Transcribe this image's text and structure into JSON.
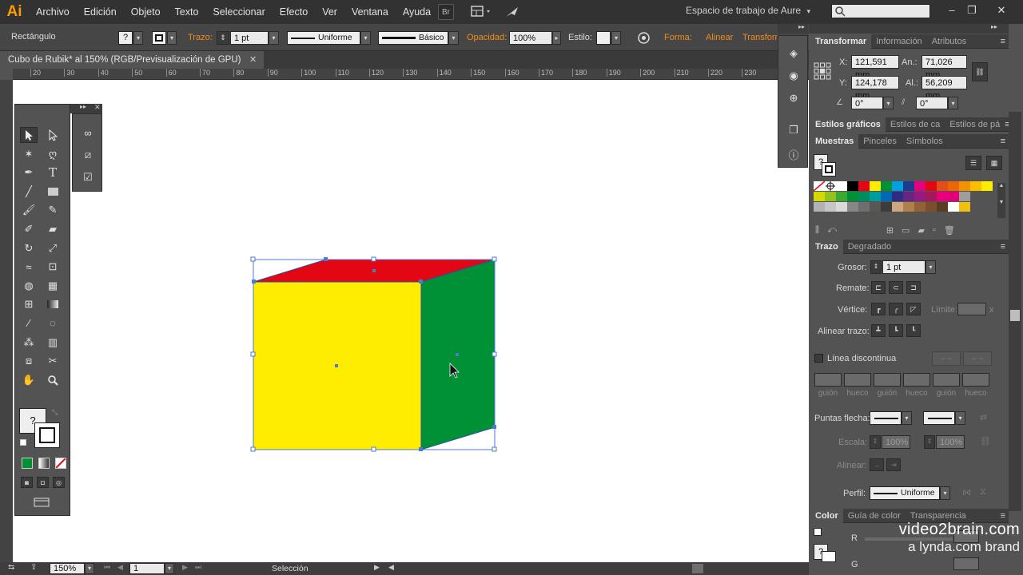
{
  "app": {
    "logo": "Ai"
  },
  "menu": [
    "Archivo",
    "Edición",
    "Objeto",
    "Texto",
    "Seleccionar",
    "Efecto",
    "Ver",
    "Ventana",
    "Ayuda"
  ],
  "menubar": {
    "bridge_label": "Br",
    "workspace": "Espacio de trabajo de Aure",
    "workspace_caret": "▾"
  },
  "controlbar": {
    "object_type": "Rectángulo",
    "fill_swatch": "?",
    "stroke_label": "Trazo:",
    "stroke_weight": "1 pt",
    "stroke_profile": "Uniforme",
    "brush": "Básico",
    "opacity_label": "Opacidad:",
    "opacity": "100%",
    "style_label": "Estilo:",
    "forma": "Forma:",
    "alinear": "Alinear",
    "transform": "Transform"
  },
  "document": {
    "tab_title": "Cubo de Rubik* al 150% (RGB/Previsualización de GPU)",
    "close": "✕"
  },
  "ruler_ticks": [
    "20",
    "30",
    "40",
    "50",
    "60",
    "70",
    "80",
    "90",
    "100",
    "110",
    "120",
    "130",
    "140",
    "150",
    "160",
    "170",
    "180",
    "190",
    "200",
    "210",
    "220",
    "230"
  ],
  "cube": {
    "front_color": "#ffed00",
    "top_color": "#e30613",
    "side_color": "#009036",
    "outline_color": "#2b4fa6"
  },
  "tools_panel": {
    "help": "?"
  },
  "transform_panel": {
    "tabs": [
      "Transformar",
      "Información",
      "Atributos"
    ],
    "x_label": "X:",
    "x": "121,591 mm",
    "w_label": "An.:",
    "w": "71,026 mm",
    "y_label": "Y:",
    "y": "124,178 mm",
    "h_label": "Al.:",
    "h": "56,209 mm",
    "angle": "0°",
    "shear": "0°"
  },
  "styles_panel": {
    "tabs": [
      "Estilos gráficos",
      "Estilos de ca",
      "Estilos de pá"
    ]
  },
  "swatches_panel": {
    "tabs": [
      "Muestras",
      "Pinceles",
      "Símbolos"
    ],
    "help": "?",
    "row1": [
      "#ffffff",
      "#000000",
      "#e30613",
      "#ffed00",
      "#009036",
      "#00a0e3",
      "#1d3a8f",
      "#e5007d",
      "#e30613",
      "#e64b1a",
      "#ec6608",
      "#f39200",
      "#fcbf00",
      "#ffed00"
    ],
    "row2": [
      "#d2da00",
      "#95c11f",
      "#3aaa35",
      "#009036",
      "#008d5e",
      "#009b9e",
      "#0069b4",
      "#2d2e83",
      "#662483",
      "#951b81",
      "#a3195b",
      "#e6007e",
      "#e2007a",
      "#9d9d9c"
    ],
    "row3": [
      "#b2b2b2",
      "#c6c6c6",
      "#dadada",
      "#878787",
      "#706f6f",
      "#575756",
      "#3c3c3b",
      "#cda77f",
      "#b17f4a",
      "#936037",
      "#7c4e2d",
      "#5c3b23",
      "#ffffff",
      "#f0c010"
    ]
  },
  "stroke_panel": {
    "tabs": [
      "Trazo",
      "Degradado"
    ],
    "weight_label": "Grosor:",
    "weight": "1 pt",
    "cap_label": "Remate:",
    "corner_label": "Vértice:",
    "limit_label": "Límite:",
    "limit_suffix": "x",
    "align_label": "Alinear trazo:",
    "dashed_label": "Línea discontinua",
    "dash_labels": [
      "guión",
      "hueco",
      "guión",
      "hueco",
      "guión",
      "hueco"
    ],
    "arrows_label": "Puntas flecha:",
    "scale_label": "Escala:",
    "scale1": "100%",
    "scale2": "100%",
    "align2_label": "Alinear:",
    "profile_label": "Perfil:",
    "profile": "Uniforme"
  },
  "color_panel": {
    "tabs": [
      "Color",
      "Guía de color",
      "Transparencia"
    ],
    "r_label": "R",
    "g_label": "G",
    "help": "?"
  },
  "statusbar": {
    "zoom": "150%",
    "page": "1",
    "status": "Selección"
  },
  "watermark": {
    "line1": "video2brain.com",
    "line2": "a lynda.com brand"
  }
}
